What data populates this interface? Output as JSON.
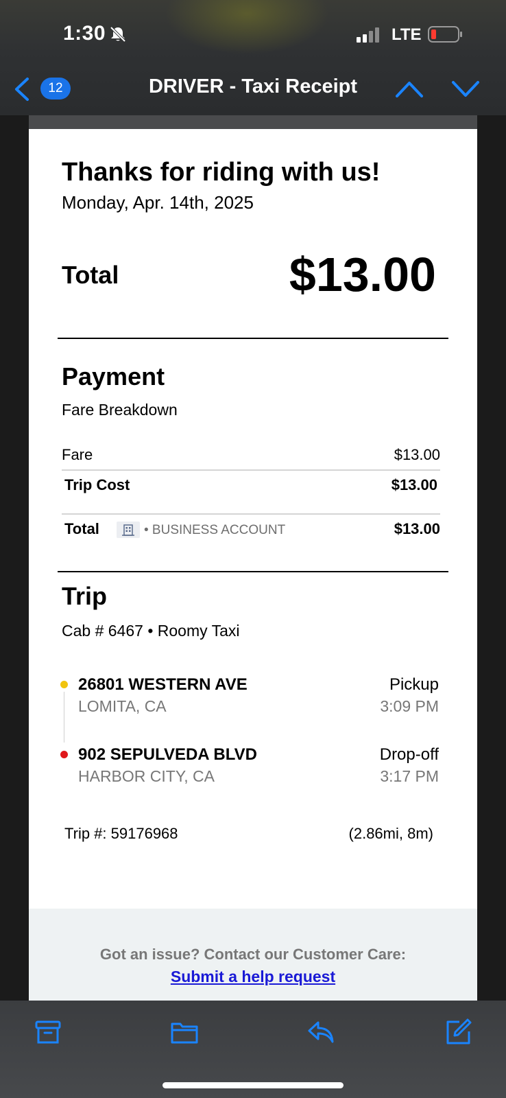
{
  "status_bar": {
    "time": "1:30",
    "network": "LTE",
    "icons": [
      "bell-slash-icon",
      "signal-icon",
      "battery-low-icon"
    ]
  },
  "nav": {
    "back_icon": "chevron-left-icon",
    "unread_count": "12",
    "title": "DRIVER - Taxi Receipt",
    "up_icon": "chevron-up-icon",
    "down_icon": "chevron-down-icon"
  },
  "receipt": {
    "heading": "Thanks for riding with us!",
    "date": "Monday, Apr. 14th, 2025",
    "total_label": "Total",
    "total_amount": "$13.00",
    "payment": {
      "title": "Payment",
      "subtitle": "Fare Breakdown",
      "rows": [
        {
          "label": "Fare",
          "amount": "$13.00"
        },
        {
          "label": "Trip Cost",
          "amount": "$13.00"
        }
      ],
      "total": {
        "label": "Total",
        "account_icon": "building-icon",
        "account": "• BUSINESS ACCOUNT",
        "amount": "$13.00"
      }
    },
    "trip": {
      "title": "Trip",
      "cab": "Cab # 6467 • Roomy Taxi",
      "pickup": {
        "address": "26801 WESTERN AVE",
        "city": "LOMITA, CA",
        "label": "Pickup",
        "time": "3:09 PM"
      },
      "dropoff": {
        "address": "902 SEPULVEDA BLVD",
        "city": "HARBOR CITY, CA",
        "label": "Drop-off",
        "time": "3:17 PM"
      },
      "trip_number": "Trip #: 59176968",
      "distance": "(2.86mi, 8m)"
    },
    "footer": {
      "text": "Got an issue? Contact our Customer Care:",
      "link": "Submit a help request"
    }
  },
  "toolbar": {
    "icons": [
      "archive-icon",
      "folder-icon",
      "reply-icon",
      "compose-icon"
    ]
  },
  "colors": {
    "accent": "#1a73e8",
    "pickup_dot": "#f1c40f",
    "dropoff_dot": "#e0181b",
    "link": "#1a1ad6"
  }
}
